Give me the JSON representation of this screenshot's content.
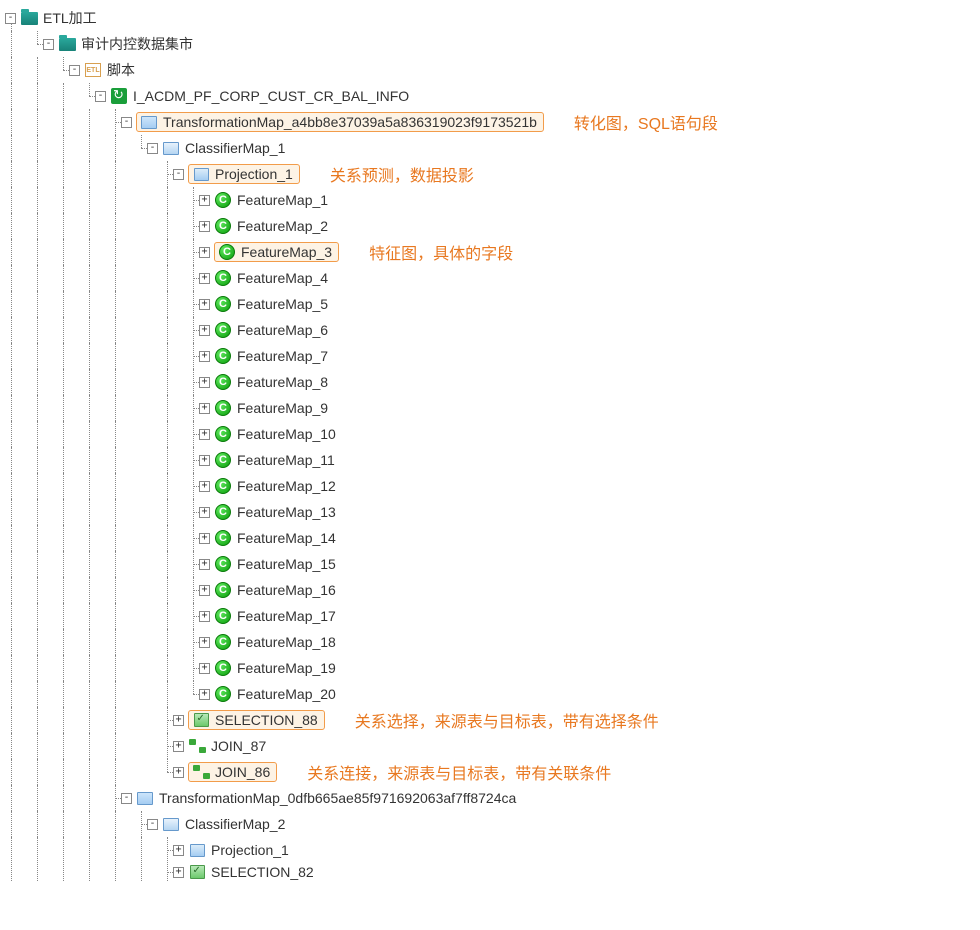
{
  "root": {
    "label": "ETL加工",
    "children": {
      "audit": {
        "label": "审计内控数据集市",
        "script": {
          "label": "脚本",
          "job": {
            "label": "I_ACDM_PF_CORP_CUST_CR_BAL_INFO",
            "tmap1": {
              "label": "TransformationMap_a4bb8e37039a5a836319023f9173521b",
              "annotation": "转化图，SQL语句段",
              "classifier": {
                "label": "ClassifierMap_1",
                "projection": {
                  "label": "Projection_1",
                  "annotation": "关系预测，数据投影",
                  "features": [
                    "FeatureMap_1",
                    "FeatureMap_2",
                    "FeatureMap_3",
                    "FeatureMap_4",
                    "FeatureMap_5",
                    "FeatureMap_6",
                    "FeatureMap_7",
                    "FeatureMap_8",
                    "FeatureMap_9",
                    "FeatureMap_10",
                    "FeatureMap_11",
                    "FeatureMap_12",
                    "FeatureMap_13",
                    "FeatureMap_14",
                    "FeatureMap_15",
                    "FeatureMap_16",
                    "FeatureMap_17",
                    "FeatureMap_18",
                    "FeatureMap_19",
                    "FeatureMap_20"
                  ],
                  "feature_annotation": "特征图，具体的字段"
                },
                "selection": {
                  "label": "SELECTION_88",
                  "annotation": "关系选择，来源表与目标表，带有选择条件"
                },
                "join87": {
                  "label": "JOIN_87"
                },
                "join86": {
                  "label": "JOIN_86",
                  "annotation": "关系连接，来源表与目标表，带有关联条件"
                }
              }
            },
            "tmap2": {
              "label": "TransformationMap_0dfb665ae85f971692063af7ff8724ca",
              "classifier": {
                "label": "ClassifierMap_2",
                "projection": {
                  "label": "Projection_1"
                },
                "selection": {
                  "label": "SELECTION_82"
                }
              }
            }
          }
        }
      }
    }
  },
  "expander": {
    "minus": "-",
    "plus": "+"
  },
  "feature_letter": "C",
  "etl_text": "ETL"
}
